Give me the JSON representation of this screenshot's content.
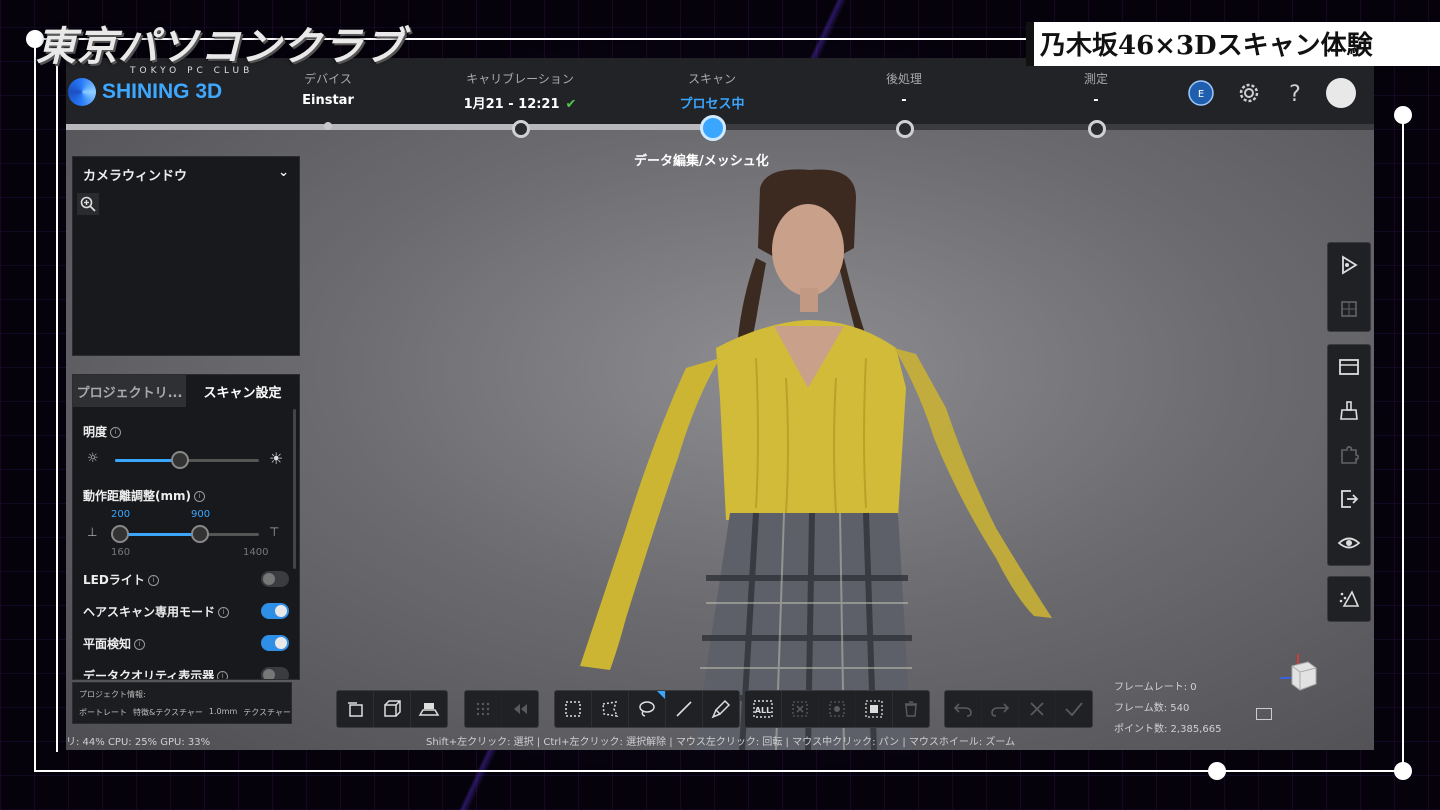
{
  "overlay": {
    "logo_main": "東京パソコンクラブ",
    "logo_sub": "TOKYO PC CLUB",
    "caption": "乃木坂46×3Dスキャン体験"
  },
  "app": {
    "brand": "SHINING 3D",
    "steps": [
      {
        "label": "デバイス",
        "value": "Einstar",
        "state": "done"
      },
      {
        "label": "キャリブレーション",
        "value": "1月21 - 12:21",
        "state": "done"
      },
      {
        "label": "スキャン",
        "value": "プロセス中",
        "state": "current"
      },
      {
        "label": "後処理",
        "value": "-",
        "state": "pending"
      },
      {
        "label": "測定",
        "value": "-",
        "state": "pending"
      }
    ],
    "sub_status": "データ編集/メッシュ化",
    "topbar_icons": [
      "einstar-logo-icon",
      "gear-icon",
      "help-icon",
      "avatar"
    ]
  },
  "camera_panel": {
    "title": "カメラウィンドウ",
    "zoom_icon": "zoom-in-icon"
  },
  "settings_panel": {
    "tabs": [
      "プロジェクトリ...",
      "スキャン設定"
    ],
    "active_tab": "スキャン設定",
    "brightness": {
      "label": "明度",
      "value": 0.46
    },
    "distance": {
      "label": "動作距離調整(mm)",
      "low": "200",
      "high": "900",
      "min": "160",
      "max": "1400"
    },
    "toggles": [
      {
        "label": "LEDライト",
        "on": false
      },
      {
        "label": "ヘアスキャン専用モード",
        "on": true
      },
      {
        "label": "平面検知",
        "on": true
      },
      {
        "label": "データクオリティ表示器",
        "on": false
      }
    ]
  },
  "project_info": {
    "title": "プロジェクト情報:",
    "items": [
      "ポートレート",
      "特徴&テクスチャー",
      "1.0mm",
      "テクスチャー"
    ]
  },
  "status": {
    "system": "リ: 44%  CPU: 25%  GPU: 33%",
    "hint": "Shift+左クリック: 選択 | Ctrl+左クリック: 選択解除 | マウス左クリック: 回転 | マウス中クリック: パン | マウスホイール: ズーム",
    "frame_rate": "フレームレート: 0",
    "frame_count": "フレーム数: 540",
    "point_count": "ポイント数: 2,385,665"
  },
  "right_toolbar": [
    [
      "cursor-play-icon",
      "grid-icon"
    ],
    [
      "window-icon",
      "brush-clean-icon",
      "puzzle-icon",
      "export-icon",
      "eye-icon"
    ],
    [
      "points-mesh-icon"
    ]
  ],
  "bottom_toolbar": [
    [
      "layer-select-icon",
      "box-view-icon",
      "scan-head-icon"
    ],
    [
      "dots-icon",
      "rewind-icon"
    ],
    [
      "rect-select-icon",
      "polygon-select-icon",
      "lasso-select-icon",
      "line-select-icon",
      "brush-select-icon"
    ],
    [
      "select-all-icon",
      "delete-x-icon",
      "expand-icon",
      "crop-icon",
      "trash-icon"
    ],
    [
      "undo-icon",
      "redo-icon",
      "cancel-icon",
      "confirm-icon"
    ]
  ],
  "colors": {
    "accent": "#3aa6ff",
    "sweater": "#d9c43a",
    "check": "#4ccb4c"
  }
}
